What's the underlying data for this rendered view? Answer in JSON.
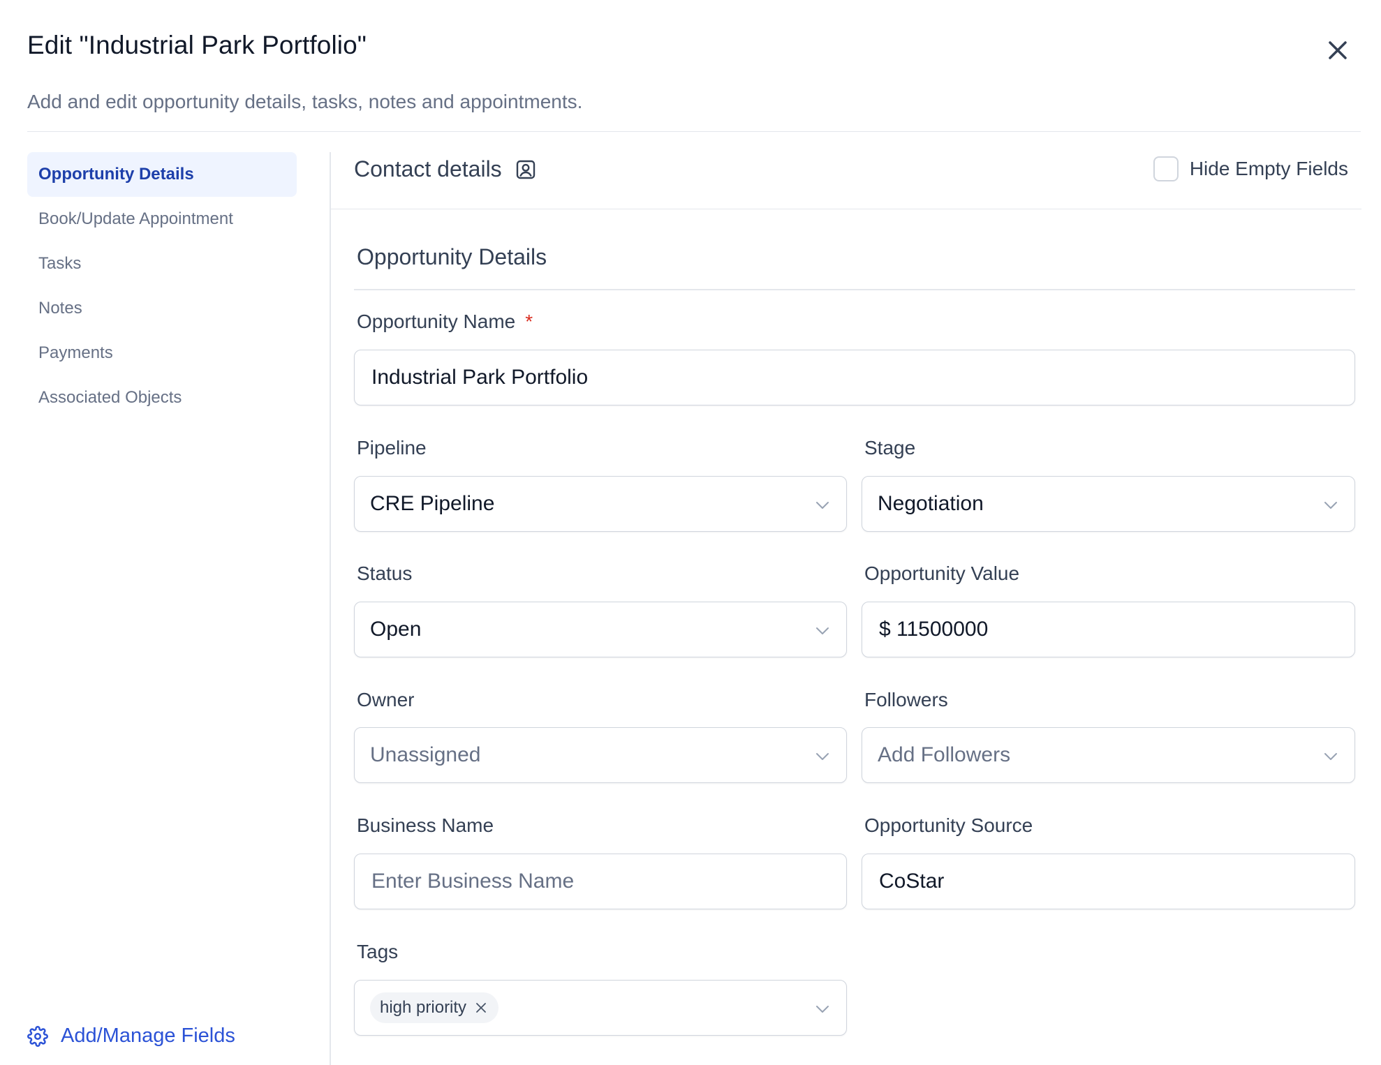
{
  "dialog": {
    "title": "Edit \"Industrial Park Portfolio\"",
    "subtitle": "Add and edit opportunity details, tasks, notes and appointments."
  },
  "sidebar": {
    "items": [
      {
        "label": "Opportunity Details",
        "active": true
      },
      {
        "label": "Book/Update Appointment",
        "active": false
      },
      {
        "label": "Tasks",
        "active": false
      },
      {
        "label": "Notes",
        "active": false
      },
      {
        "label": "Payments",
        "active": false
      },
      {
        "label": "Associated Objects",
        "active": false
      }
    ],
    "manage_fields_label": "Add/Manage Fields"
  },
  "contact": {
    "title": "Contact details",
    "hide_empty_label": "Hide Empty Fields",
    "hide_empty_checked": false
  },
  "form": {
    "section_title": "Opportunity Details",
    "opportunity_name": {
      "label": "Opportunity Name",
      "required_mark": "*",
      "value": "Industrial Park Portfolio"
    },
    "pipeline": {
      "label": "Pipeline",
      "value": "CRE Pipeline"
    },
    "stage": {
      "label": "Stage",
      "value": "Negotiation"
    },
    "status": {
      "label": "Status",
      "value": "Open"
    },
    "opportunity_value": {
      "label": "Opportunity Value",
      "value": "$ 11500000"
    },
    "owner": {
      "label": "Owner",
      "placeholder": "Unassigned"
    },
    "followers": {
      "label": "Followers",
      "placeholder": "Add Followers"
    },
    "business_name": {
      "label": "Business Name",
      "placeholder": "Enter Business Name"
    },
    "opportunity_source": {
      "label": "Opportunity Source",
      "value": "CoStar"
    },
    "tags": {
      "label": "Tags",
      "values": [
        "high priority"
      ]
    }
  },
  "colors": {
    "accent": "#2b52d6",
    "active_bg": "#eff4ff",
    "required": "#d92d20",
    "border": "#d0d5dd"
  }
}
